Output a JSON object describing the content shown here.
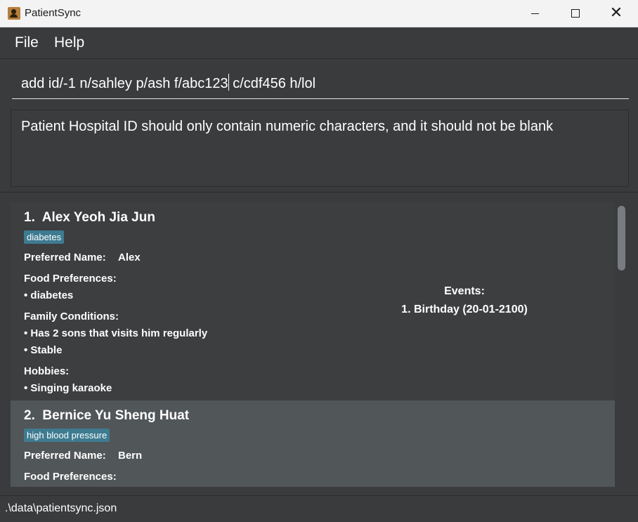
{
  "window": {
    "title": "PatientSync",
    "app_icon": "contact-card-icon",
    "controls": [
      "minimize-icon",
      "maximize-icon",
      "close-icon"
    ]
  },
  "menu": {
    "file": "File",
    "help": "Help"
  },
  "command": {
    "value_before_caret": "add id/-1 n/sahley p/ash f/abc123",
    "value_after_caret": " c/cdf456 h/lol"
  },
  "result": {
    "message": "Patient Hospital ID should only contain numeric characters, and it should not be blank"
  },
  "patients": [
    {
      "index": "1.",
      "name": "Alex Yeoh Jia Jun",
      "tag": "diabetes",
      "preferred_name_label": "Preferred Name:",
      "preferred_name": "Alex",
      "food_label": "Food Preferences:",
      "food": [
        "• diabetes"
      ],
      "family_label": "Family Conditions:",
      "family": [
        "• Has 2 sons that visits him regularly",
        "• Stable"
      ],
      "hobbies_label": "Hobbies:",
      "hobbies": [
        "• Singing karaoke"
      ],
      "events_label": "Events:",
      "events": [
        "1. Birthday (20-01-2100)"
      ]
    },
    {
      "index": "2.",
      "name": "Bernice Yu Sheng Huat",
      "tag": "high blood pressure",
      "preferred_name_label": "Preferred Name:",
      "preferred_name": "Bern",
      "food_label": "Food Preferences:"
    }
  ],
  "status": {
    "file_path": ".\\data\\patientsync.json"
  },
  "colors": {
    "background": "#3a3b3d",
    "tag": "#3e7b91",
    "selected_card": "#515658"
  }
}
